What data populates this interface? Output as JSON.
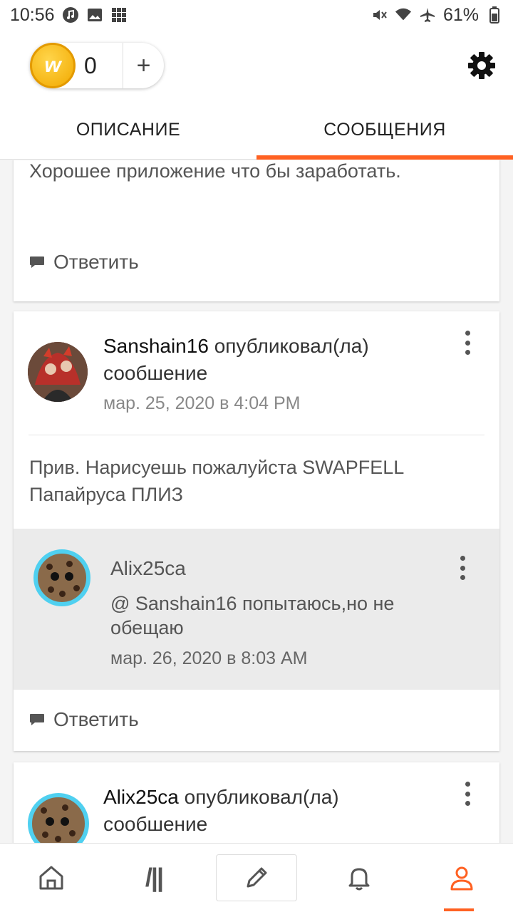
{
  "status_bar": {
    "time": "10:56",
    "battery": "61%",
    "icons_left": [
      "music-icon",
      "image-icon",
      "grid-icon"
    ],
    "icons_right": [
      "mute-icon",
      "wifi-icon",
      "airplane-icon",
      "battery-icon"
    ]
  },
  "header": {
    "coin_count": "0",
    "coin_symbol": "w",
    "plus_label": "+"
  },
  "tabs": [
    {
      "label": "ОПИСАНИЕ",
      "active": false
    },
    {
      "label": "СООБЩЕНИЯ",
      "active": true
    }
  ],
  "feed": {
    "card1": {
      "message": "Хорошее приложение что бы заработать.",
      "reply_label": "Ответить"
    },
    "card2": {
      "author": "Sanshain16",
      "action": "опубликовал(ла) сообшение",
      "date": "мар. 25, 2020 в 4:04 PM",
      "body": "Прив. Нарисуешь пожалуйста SWAPFELL Папайруса ПЛИЗ",
      "reply": {
        "author": "Alix25ca",
        "text": "@ Sanshain16  попытаюсь,но не обещаю",
        "date": "мар. 26, 2020 в 8:03 AM"
      },
      "reply_label": "Ответить"
    },
    "card3": {
      "author": "Alix25ca",
      "action": "опубликовал(ла) сообшение"
    }
  },
  "bottom_nav": [
    {
      "name": "home-icon",
      "active": false
    },
    {
      "name": "library-icon",
      "active": false,
      "glyph": "/||"
    },
    {
      "name": "write-icon",
      "active": false
    },
    {
      "name": "notifications-icon",
      "active": false
    },
    {
      "name": "profile-icon",
      "active": true
    }
  ],
  "colors": {
    "accent": "#ff6122",
    "avatar_ring": "#4fd0f0",
    "coin": "#f2a900"
  }
}
